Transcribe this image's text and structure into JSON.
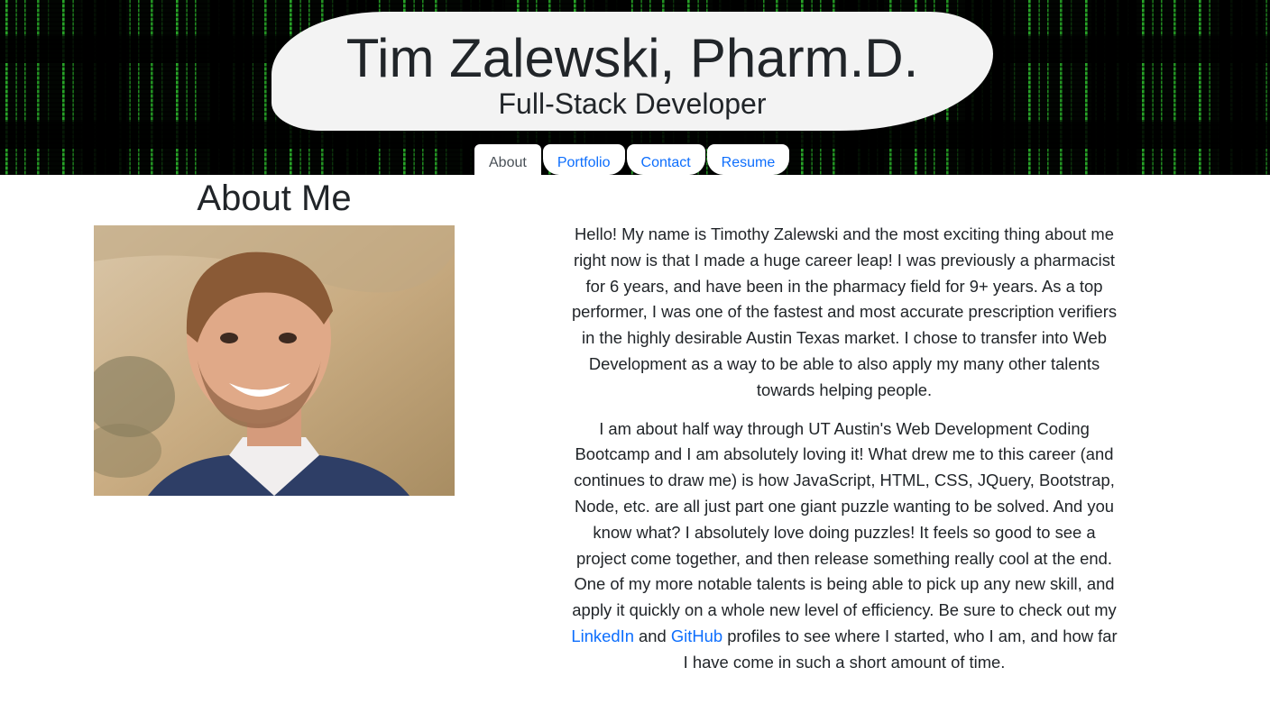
{
  "header": {
    "name": "Tim Zalewski, Pharm.D.",
    "role": "Full-Stack Developer",
    "background_color": "#030803",
    "accent_green": "#2fbf2f"
  },
  "nav": {
    "tabs": [
      {
        "label": "About",
        "active": true
      },
      {
        "label": "Portfolio",
        "active": false
      },
      {
        "label": "Contact",
        "active": false
      },
      {
        "label": "Resume",
        "active": false
      }
    ],
    "link_color": "#0d6efd"
  },
  "about": {
    "title": "About Me",
    "photo_alt": "portrait-photo",
    "paragraph1": "Hello! My name is Timothy Zalewski and the most exciting thing about me right now is that I made a huge career leap! I was previously a pharmacist for 6 years, and have been in the pharmacy field for 9+ years. As a top performer, I was one of the fastest and most accurate prescription verifiers in the highly desirable Austin Texas market. I chose to transfer into Web Development as a way to be able to also apply my many other talents towards helping people.",
    "paragraph2_a": "I am about half way through UT Austin's Web Development Coding Bootcamp and I am absolutely loving it! What drew me to this career (and continues to draw me) is how JavaScript, HTML, CSS, JQuery, Bootstrap, Node, etc. are all just part one giant puzzle wanting to be solved. And you know what? I absolutely love doing puzzles! It feels so good to see a project come together, and then release something really cool at the end. One of my more notable talents is being able to pick up any new skill, and apply it quickly on a whole new level of efficiency. Be sure to check out my ",
    "linkedin_label": "LinkedIn",
    "paragraph2_b": " and ",
    "github_label": "GitHub",
    "paragraph2_c": " profiles to see where I started, who I am, and how far I have come in such a short amount of time."
  }
}
